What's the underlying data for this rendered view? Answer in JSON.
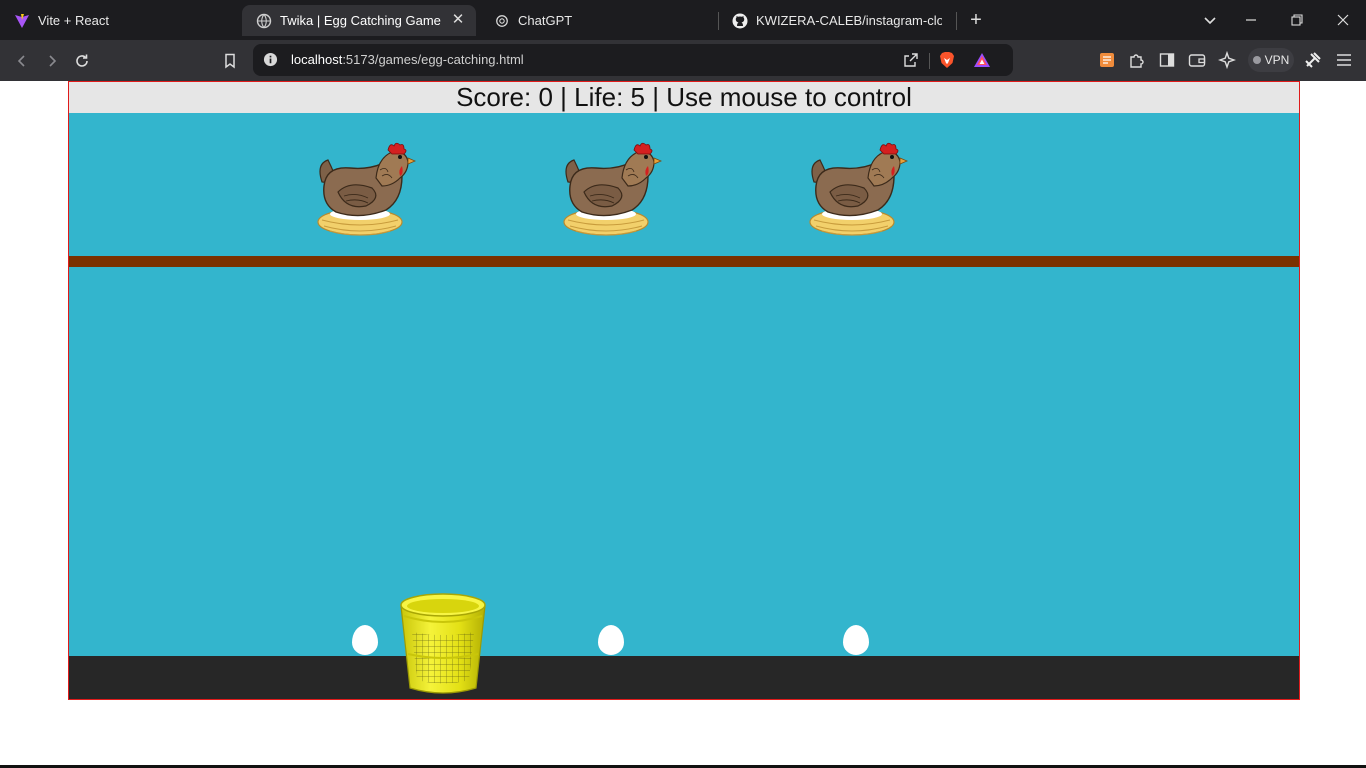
{
  "browser": {
    "tabs": [
      {
        "title": "Vite + React",
        "icon": "vite-icon",
        "active": false
      },
      {
        "title": "Twika | Egg Catching Game",
        "icon": "globe-icon",
        "active": true
      },
      {
        "title": "ChatGPT",
        "icon": "chatgpt-icon",
        "active": false
      },
      {
        "title": "KWIZERA-CALEB/instagram-clone: T",
        "icon": "github-icon",
        "active": false
      }
    ],
    "address": {
      "host": "localhost",
      "path": ":5173/games/egg-catching.html"
    },
    "vpn_label": "VPN"
  },
  "game": {
    "score_label": "Score:",
    "score": "0",
    "life_label": "Life:",
    "life": "5",
    "hint": "Use mouse to control",
    "separator": "|",
    "colors": {
      "sky": "#33b5cd",
      "ledge": "#7a3100",
      "ground": "#272727",
      "scorebar": "#e6e6e6",
      "border": "#e01b1b"
    },
    "hens": [
      {
        "id": "hen-1"
      },
      {
        "id": "hen-2"
      },
      {
        "id": "hen-3"
      }
    ],
    "eggs": [
      {
        "id": "egg-1"
      },
      {
        "id": "egg-2"
      },
      {
        "id": "egg-3"
      }
    ],
    "basket": {
      "icon": "basket-icon"
    }
  }
}
